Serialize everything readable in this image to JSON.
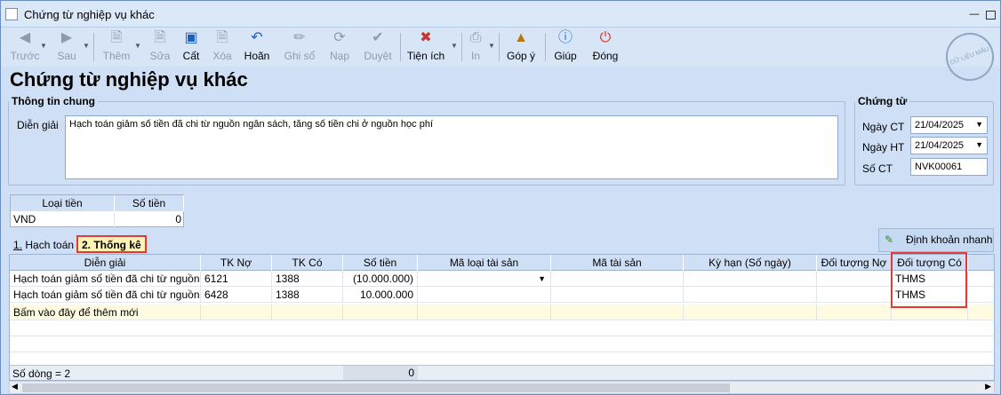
{
  "window": {
    "title": "Chứng từ nghiệp vụ khác"
  },
  "toolbar": [
    {
      "key": "prev",
      "label": "Trước",
      "icon": "arrow-left-icon",
      "enabled": false,
      "dropdown": true
    },
    {
      "key": "next",
      "label": "Sau",
      "icon": "arrow-right-icon",
      "enabled": false,
      "dropdown": true
    },
    {
      "key": "add",
      "label": "Thêm",
      "icon": "new-doc-icon",
      "enabled": false,
      "dropdown": true
    },
    {
      "key": "edit",
      "label": "Sửa",
      "icon": "edit-doc-icon",
      "enabled": false
    },
    {
      "key": "save",
      "label": "Cất",
      "icon": "save-icon",
      "enabled": true
    },
    {
      "key": "delete",
      "label": "Xóa",
      "icon": "delete-doc-icon",
      "enabled": false
    },
    {
      "key": "undo",
      "label": "Hoãn",
      "icon": "undo-icon",
      "enabled": true
    },
    {
      "key": "post",
      "label": "Ghi sổ",
      "icon": "pencil-icon",
      "enabled": false
    },
    {
      "key": "reload",
      "label": "Nạp",
      "icon": "refresh-icon",
      "enabled": false
    },
    {
      "key": "approve",
      "label": "Duyệt",
      "icon": "check-icon",
      "enabled": false
    },
    {
      "key": "utilities",
      "label": "Tiện ích",
      "icon": "tools-icon",
      "enabled": true,
      "dropdown": true
    },
    {
      "key": "print",
      "label": "In",
      "icon": "printer-icon",
      "enabled": false,
      "dropdown": true
    },
    {
      "key": "feedback",
      "label": "Góp ý",
      "icon": "feedback-icon",
      "enabled": true
    },
    {
      "key": "help",
      "label": "Giúp",
      "icon": "help-icon",
      "enabled": true
    },
    {
      "key": "close",
      "label": "Đóng",
      "icon": "power-icon",
      "enabled": true
    }
  ],
  "page": {
    "title": "Chứng từ nghiệp vụ khác",
    "stamp": "DỮ LIỆU MẪU"
  },
  "general": {
    "legend": "Thông tin chung",
    "desc_label": "Diễn giải",
    "desc_value": "Hạch toán giảm số tiền đã chi từ nguồn ngân sách, tăng số tiền chi ở nguồn học phí"
  },
  "voucher": {
    "legend": "Chứng từ",
    "date_ct_label": "Ngày CT",
    "date_ct": "21/04/2025",
    "date_ht_label": "Ngày HT",
    "date_ht": "21/04/2025",
    "no_label": "Số CT",
    "no": "NVK00061"
  },
  "currency": {
    "h_type": "Loại tiền",
    "h_amount": "Số tiền",
    "type": "VND",
    "amount": "0"
  },
  "tabs": {
    "tab1_num": "1.",
    "tab1_label": " Hạch toán",
    "tab2": "2. Thống kê"
  },
  "quick_btn": "Định khoản nhanh",
  "grid": {
    "headers": [
      "Diễn giải",
      "TK Nợ",
      "TK Có",
      "Số tiền",
      "Mã loại tài sản",
      "Mã tài sản",
      "Kỳ hạn (Số ngày)",
      "Đối tượng Nợ",
      "Đối tượng Có"
    ],
    "rows": [
      [
        "Hạch toán giảm số tiền đã chi từ nguồn...",
        "6121",
        "1388",
        "(10.000.000)",
        "",
        "",
        "",
        "",
        "THMS"
      ],
      [
        "Hạch toán giảm số tiền đã chi từ nguồn...",
        "6428",
        "1388",
        "10.000.000",
        "",
        "",
        "",
        "",
        "THMS"
      ]
    ],
    "add_row": "Bấm vào đây để thêm mới",
    "footer_count": "Số dòng = 2",
    "footer_total": "0"
  }
}
